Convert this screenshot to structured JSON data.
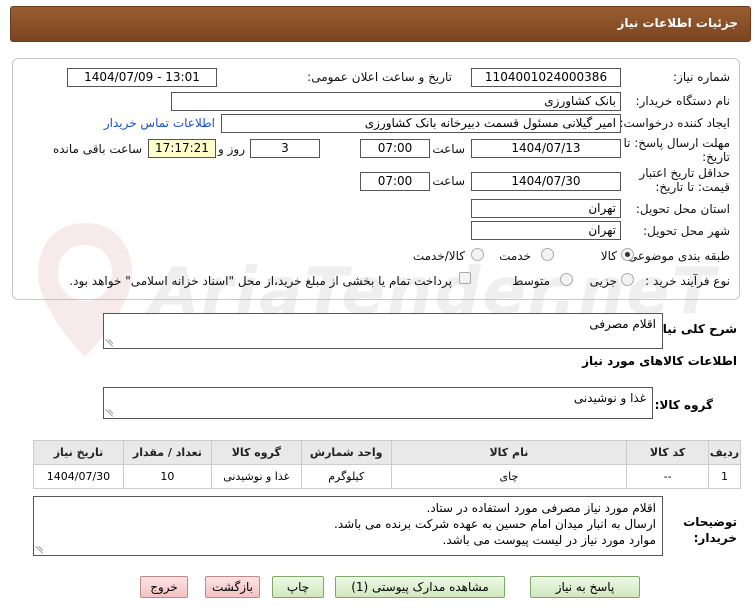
{
  "header": {
    "title": "جزئیات اطلاعات نیاز"
  },
  "form": {
    "need_number_label": "شماره نیاز:",
    "need_number": "1104001024000386",
    "announce_label": "تاریخ و ساعت اعلان عمومی:",
    "announce_value": "1404/07/09 - 13:01",
    "buyer_org_label": "نام دستگاه خریدار:",
    "buyer_org": "بانک کشاورزی",
    "creator_label": "ایجاد کننده درخواست:",
    "creator": "امیر گیلانی مسئول قسمت دبیرخانه بانک کشاورزی",
    "contact_link": "اطلاعات تماس خریدار",
    "deadline_label": "مهلت ارسال پاسخ: تا تاریخ:",
    "deadline_date": "1404/07/13",
    "time_label": "ساعت",
    "deadline_time": "07:00",
    "days_value": "3",
    "days_label": "روز و",
    "remaining_time": "17:17:21",
    "remaining_label": "ساعت باقی مانده",
    "validity_label": "حداقل تاریخ اعتبار قیمت: تا تاریخ:",
    "validity_date": "1404/07/30",
    "validity_time": "07:00",
    "province_label": "استان محل تحویل:",
    "province": "تهران",
    "city_label": "شهر محل تحویل:",
    "city": "تهران",
    "category_label": "طبقه بندی موضوعی:",
    "category_options": [
      "کالا",
      "خدمت",
      "کالا/خدمت"
    ],
    "process_label": "نوع فرآیند خرید :",
    "process_options": [
      "جزیی",
      "متوسط"
    ],
    "payment_note": "پرداخت تمام یا بخشی از مبلغ خرید،از محل \"اسناد خزانه اسلامی\" خواهد بود."
  },
  "summary": {
    "label": "شرح کلی نیاز:",
    "value": "اقلام مصرفی"
  },
  "goods_section": {
    "title": "اطلاعات کالاهای مورد نیاز",
    "group_label": "گروه کالا:",
    "group_value": "غذا و نوشیدنی"
  },
  "table": {
    "headers": [
      "ردیف",
      "کد کالا",
      "نام کالا",
      "واحد شمارش",
      "گروه کالا",
      "تعداد / مقدار",
      "تاریخ نیاز"
    ],
    "rows": [
      [
        "1",
        "--",
        "چای",
        "کیلوگرم",
        "غذا و نوشیدنی",
        "10",
        "1404/07/30"
      ]
    ]
  },
  "notes": {
    "label": "توضیحات خریدار:",
    "lines": [
      "اقلام مورد نیاز مصرفی مورد استفاده در ستاد.",
      "ارسال به انبار میدان امام حسین به عهده شرکت برنده می باشد.",
      "موارد مورد نیاز در لیست پیوست می باشد."
    ]
  },
  "buttons": {
    "reply": "پاسخ به نیاز",
    "attachments": "مشاهده مدارک پیوستی (1)",
    "print": "چاپ",
    "back": "بازگشت",
    "exit": "خروج"
  },
  "watermark": {
    "text": "AriaTender.neT"
  },
  "colors": {
    "header": "#8a5029",
    "link": "#1a4fd0",
    "green_button": "#cfe8bd",
    "pink_button": "#f5c1c1",
    "remaining_bg": "#ffffcc"
  }
}
